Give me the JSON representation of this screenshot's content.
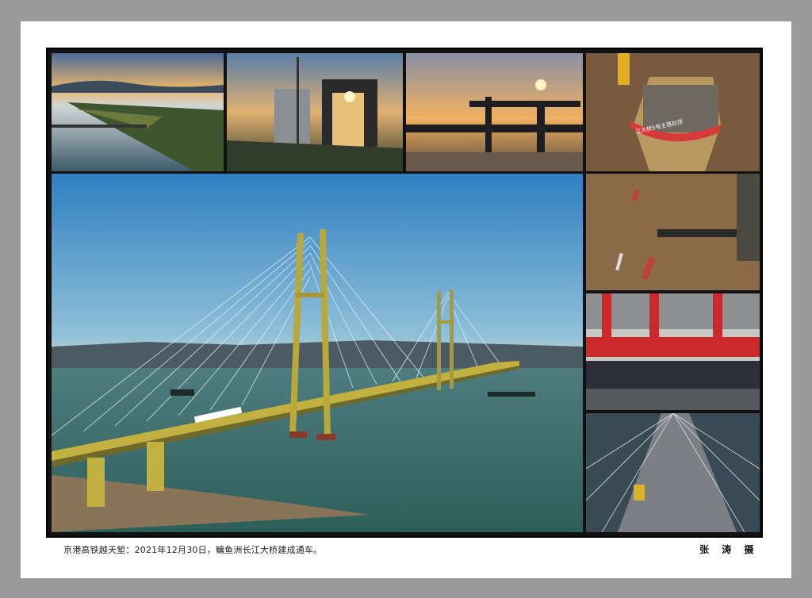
{
  "caption": "京港高铁越天堑：2021年12月30日，鳊鱼洲长江大桥建成通车。",
  "credit": "张 涛 摄",
  "banner_text": "江大桥5号主塔封顶"
}
